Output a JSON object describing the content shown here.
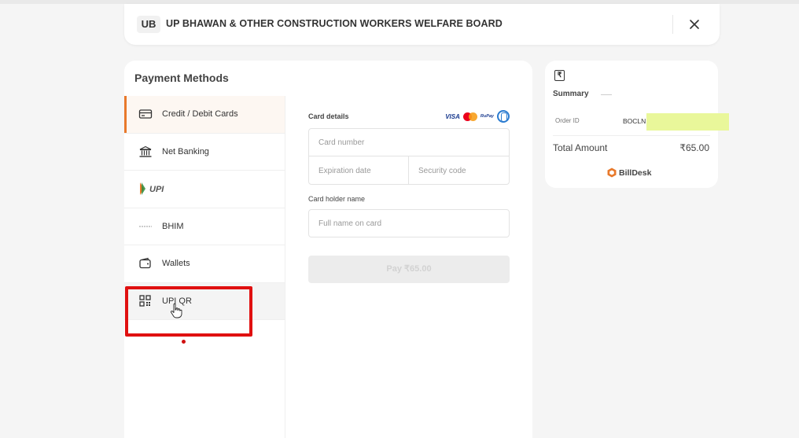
{
  "header": {
    "abbr": "UB",
    "title": "UP BHAWAN & OTHER CONSTRUCTION WORKERS WELFARE BOARD"
  },
  "payment": {
    "title": "Payment Methods",
    "methods": [
      {
        "label": "Credit / Debit Cards",
        "icon": "credit-card-icon"
      },
      {
        "label": "Net Banking",
        "icon": "bank-icon"
      },
      {
        "label": "UPI",
        "icon": "upi-icon"
      },
      {
        "label": "BHIM",
        "icon": "bhim-icon"
      },
      {
        "label": "Wallets",
        "icon": "wallet-icon"
      },
      {
        "label": "UPI QR",
        "icon": "qr-code-icon"
      }
    ]
  },
  "card": {
    "details_label": "Card details",
    "number_placeholder": "Card number",
    "expiry_placeholder": "Expiration date",
    "cvv_placeholder": "Security code",
    "holder_label": "Card holder name",
    "holder_placeholder": "Full name on card",
    "pay_label": "Pay ₹65.00",
    "brands": {
      "visa": "VISA",
      "rupay": "RuPay"
    }
  },
  "summary": {
    "title": "Summary",
    "order_id_label": "Order ID",
    "order_id_value": "BOCLN",
    "total_label": "Total Amount",
    "total_value": "₹65.00",
    "currency_symbol": "₹",
    "provider": "BillDesk"
  },
  "colors": {
    "accent": "#e8792b",
    "highlight_box": "#e01010",
    "redaction": "#e9f79a"
  }
}
